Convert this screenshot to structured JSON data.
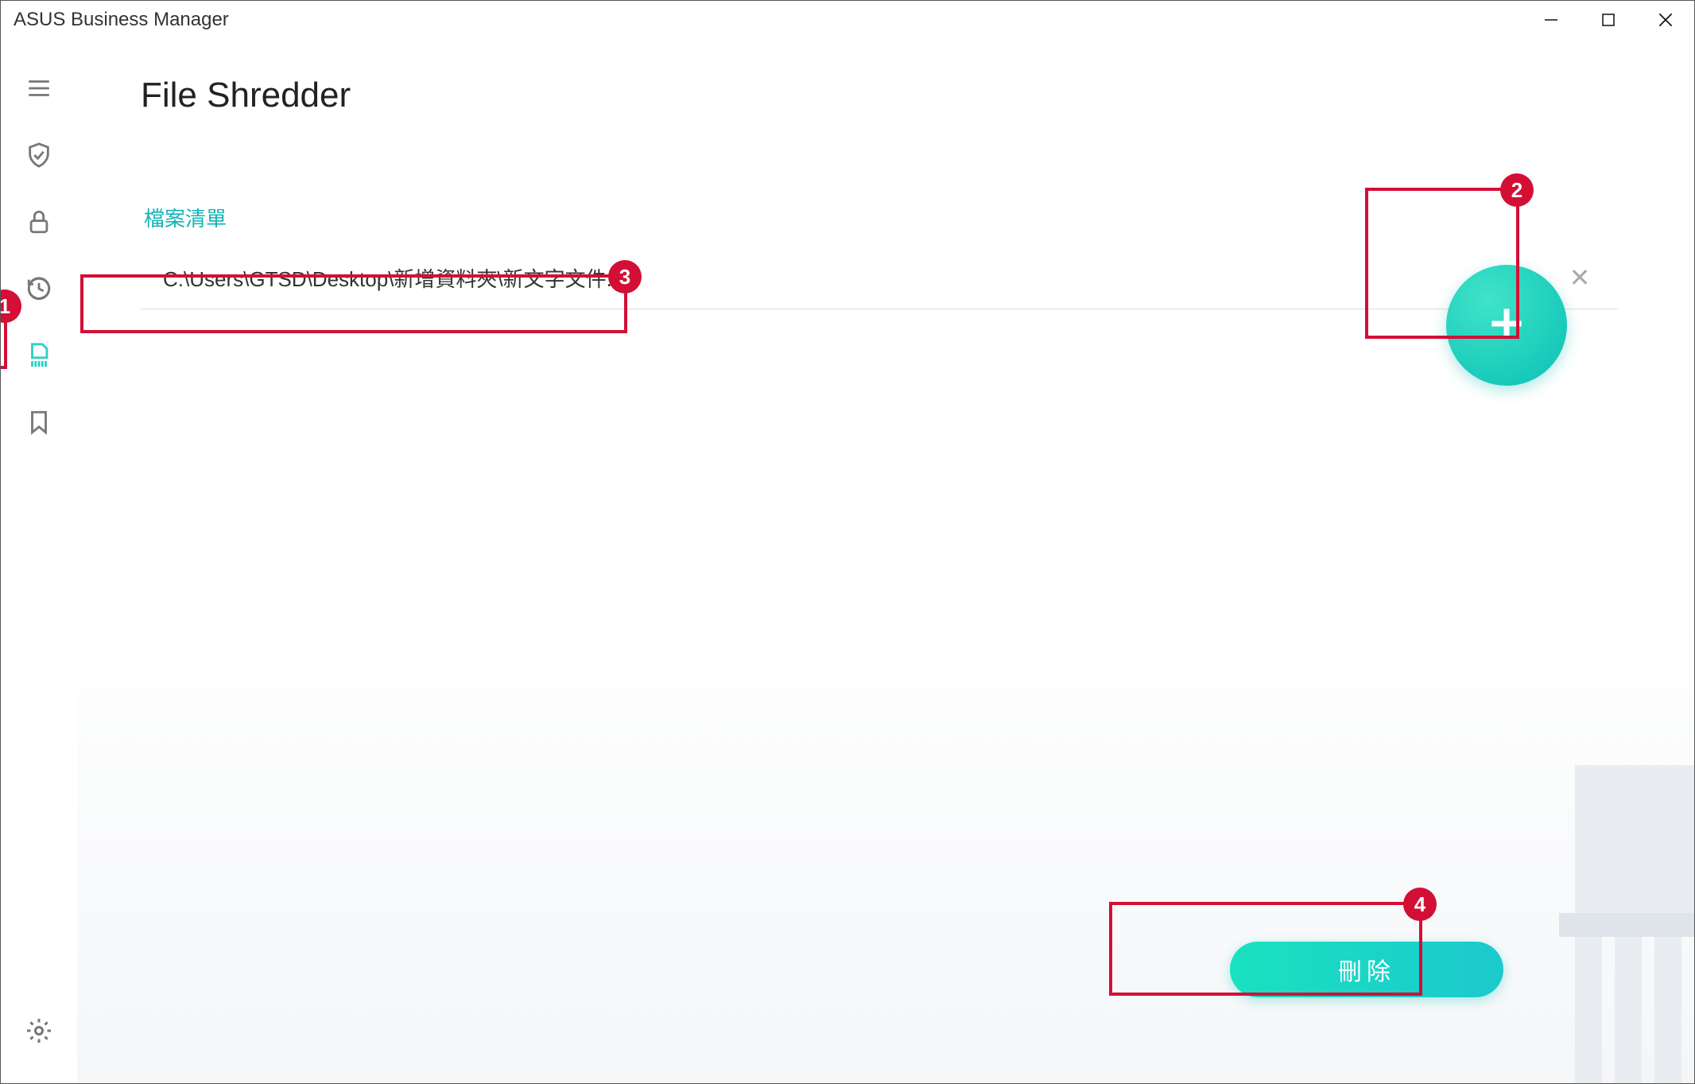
{
  "window": {
    "title": "ASUS Business Manager"
  },
  "sidebar": {
    "items": [
      {
        "icon": "menu"
      },
      {
        "icon": "shield"
      },
      {
        "icon": "lock"
      },
      {
        "icon": "history"
      },
      {
        "icon": "file-shred",
        "active": true
      },
      {
        "icon": "bookmark"
      }
    ],
    "bottom": {
      "icon": "gear"
    }
  },
  "main": {
    "page_title": "File Shredder",
    "section_label": "檔案清單",
    "files": [
      {
        "path": "C:\\Users\\GTSD\\Desktop\\新增資料夾\\新文字文件.txt"
      }
    ],
    "add_button": {
      "label": "+"
    },
    "delete_button": {
      "label": "刪除"
    }
  },
  "callouts": [
    {
      "n": "1",
      "pos": "sidebar-file-shred"
    },
    {
      "n": "2",
      "pos": "add-fab"
    },
    {
      "n": "3",
      "pos": "file-path"
    },
    {
      "n": "4",
      "pos": "delete-btn"
    }
  ]
}
